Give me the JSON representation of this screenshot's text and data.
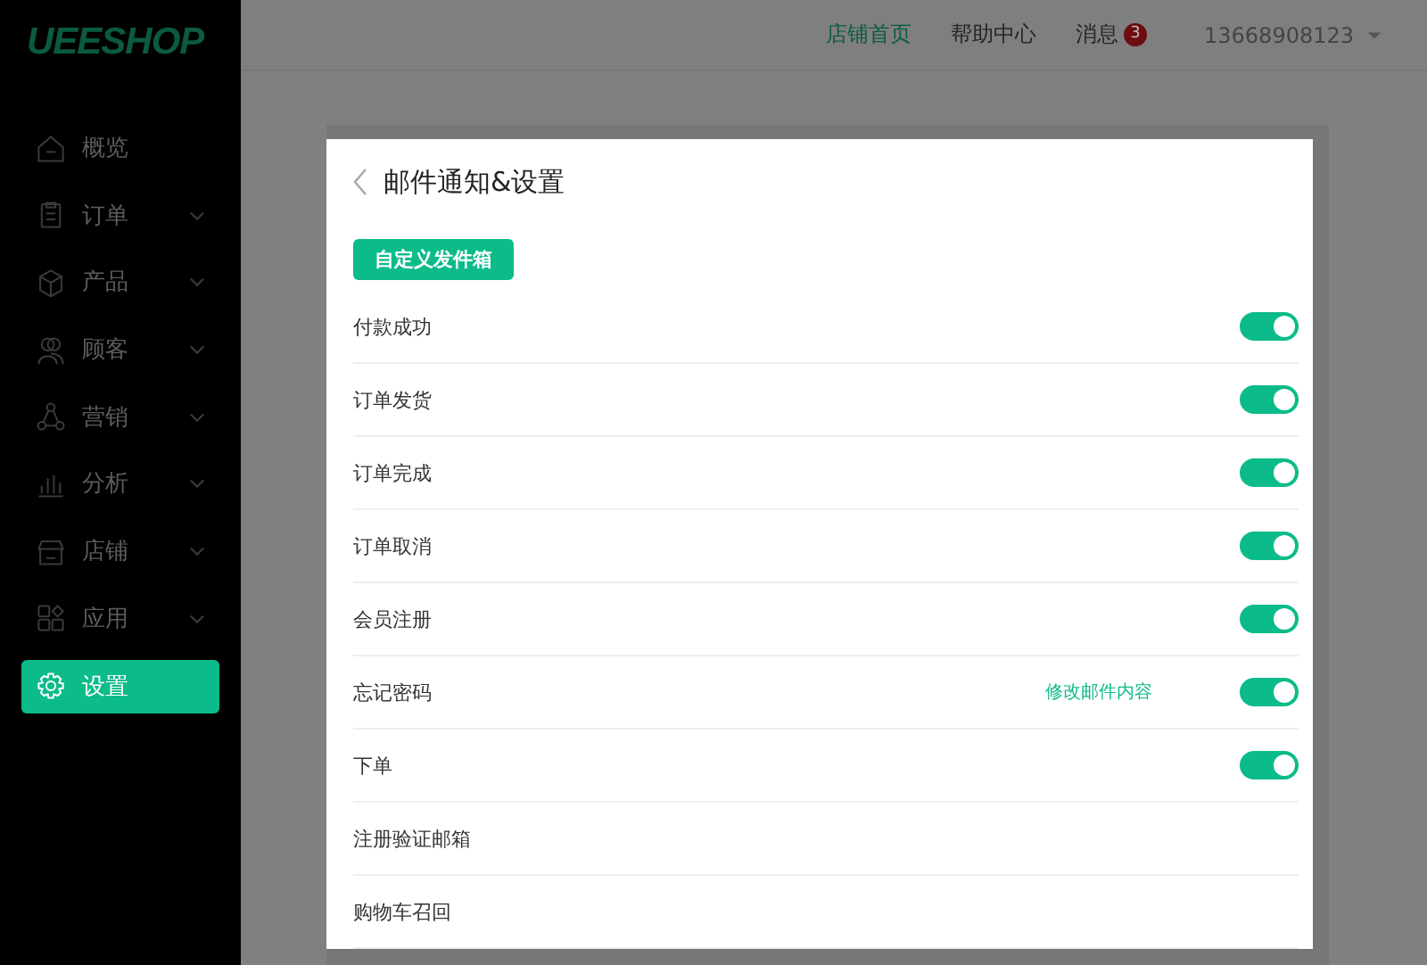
{
  "logo": "UEESHOP",
  "sidebar": {
    "items": [
      {
        "label": "概览",
        "expandable": false,
        "selected": false
      },
      {
        "label": "订单",
        "expandable": true,
        "selected": false
      },
      {
        "label": "产品",
        "expandable": true,
        "selected": false
      },
      {
        "label": "顾客",
        "expandable": true,
        "selected": false
      },
      {
        "label": "营销",
        "expandable": true,
        "selected": false
      },
      {
        "label": "分析",
        "expandable": true,
        "selected": false
      },
      {
        "label": "店铺",
        "expandable": true,
        "selected": false
      },
      {
        "label": "应用",
        "expandable": true,
        "selected": false
      },
      {
        "label": "设置",
        "expandable": false,
        "selected": true
      }
    ]
  },
  "topbar": {
    "links": [
      {
        "label": "店铺首页",
        "selected": true
      },
      {
        "label": "帮助中心",
        "selected": false
      }
    ],
    "messages": {
      "label": "消息",
      "badge": "3"
    },
    "account": "13668908123"
  },
  "dialog": {
    "title": "邮件通知&设置",
    "button": "自定义发件箱",
    "rows": [
      {
        "kind": "toggle",
        "label": "付款成功",
        "on": true
      },
      {
        "kind": "toggle",
        "label": "订单发货",
        "on": true
      },
      {
        "kind": "toggle",
        "label": "订单完成",
        "on": true
      },
      {
        "kind": "toggle",
        "label": "订单取消",
        "on": true
      },
      {
        "kind": "toggle",
        "label": "会员注册",
        "on": true
      },
      {
        "kind": "toggle",
        "label": "忘记密码",
        "on": true,
        "link": "修改邮件内容"
      },
      {
        "kind": "toggle",
        "label": "下单",
        "on": true
      },
      {
        "kind": "plain",
        "label": "注册验证邮箱"
      },
      {
        "kind": "plain",
        "label": "购物车召回"
      }
    ]
  }
}
